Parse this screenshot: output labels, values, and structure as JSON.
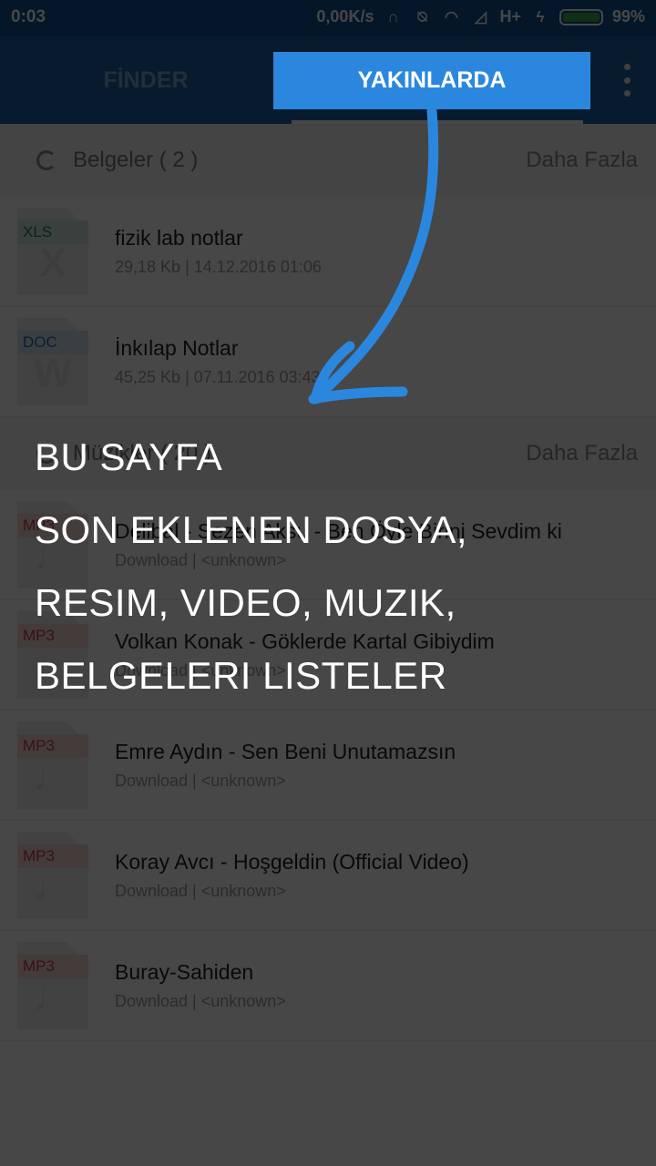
{
  "status_bar": {
    "time": "0:03",
    "net_speed": "0,00K/s",
    "network": "H+",
    "battery": "99%",
    "icons": [
      "headset-icon",
      "alarm-off-icon",
      "wifi-icon",
      "signal-icon",
      "signal-icon",
      "charging-icon"
    ]
  },
  "tabs": {
    "finder": "FİNDER",
    "recent": "YAKINLARDA"
  },
  "sections": [
    {
      "title": "Belgeler ( 2 )",
      "more": "Daha Fazla",
      "items": [
        {
          "type": "XLS",
          "glyph": "X",
          "name": "fizik lab notlar",
          "meta": "29,18 Kb | 14.12.2016 01:06"
        },
        {
          "type": "DOC",
          "glyph": "W",
          "name": "İnkılap Notlar",
          "meta": "45,25 Kb | 07.11.2016 03:43"
        }
      ]
    },
    {
      "title": "Müzikler ( 20 )",
      "more": "Daha Fazla",
      "items": [
        {
          "type": "MP3",
          "glyph": "♩",
          "name": "Delibal - Sezen Aksu -  Ben Öyle Birini Sevdim ki",
          "meta": "Download | <unknown>"
        },
        {
          "type": "MP3",
          "glyph": "♩",
          "name": "Volkan Konak - Göklerde Kartal Gibiydim",
          "meta": "Download | <unknown>"
        },
        {
          "type": "MP3",
          "glyph": "♩",
          "name": "Emre Aydın - Sen Beni Unutamazsın",
          "meta": "Download | <unknown>"
        },
        {
          "type": "MP3",
          "glyph": "♩",
          "name": "Koray Avcı - Hoşgeldin (Official Video)",
          "meta": "Download | <unknown>"
        },
        {
          "type": "MP3",
          "glyph": "♩",
          "name": "Buray-Sahiden",
          "meta": "Download | <unknown>"
        }
      ]
    }
  ],
  "overlay": {
    "lines": [
      "BU SAYFA",
      "SON EKLENEN DOSYA,",
      "RESIM, VIDEO, MUZIK,",
      "BELGELERI LISTELER"
    ]
  },
  "colors": {
    "appbar": "#1d61a6",
    "highlight": "#2b87de",
    "arrow": "#2b87de",
    "xls": "#1f8a55",
    "doc": "#2e6aaf",
    "mp3": "#c9413a"
  }
}
